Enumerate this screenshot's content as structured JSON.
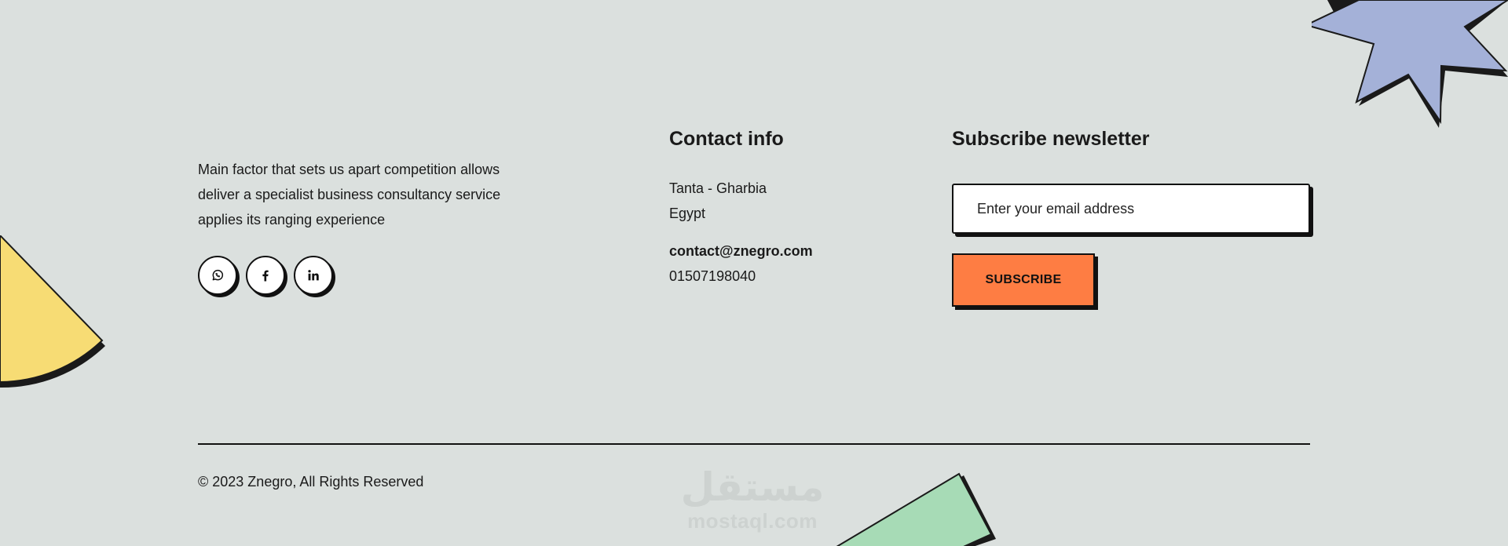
{
  "about": {
    "text": "Main factor that sets us apart competition allows deliver a specialist business consultancy service applies its ranging experience"
  },
  "social": [
    {
      "icon": "whatsapp-icon"
    },
    {
      "icon": "facebook-icon"
    },
    {
      "icon": "linkedin-icon"
    }
  ],
  "contact": {
    "title": "Contact info",
    "city": "Tanta - Gharbia",
    "country": "Egypt",
    "email": "contact@znegro.com",
    "phone": "01507198040"
  },
  "newsletter": {
    "title": "Subscribe newsletter",
    "placeholder": "Enter your email address",
    "button_label": "SUBSCRIBE"
  },
  "footer": {
    "copyright": "© 2023 Znegro, All Rights Reserved"
  },
  "watermark": {
    "arabic": "مستقل",
    "latin": "mostaql.com"
  },
  "colors": {
    "background": "#dbe0de",
    "accent_orange": "#fe7d43",
    "shape_yellow": "#f7dc74",
    "shape_blue": "#a4b1d8",
    "shape_green": "#a7dbb6"
  }
}
